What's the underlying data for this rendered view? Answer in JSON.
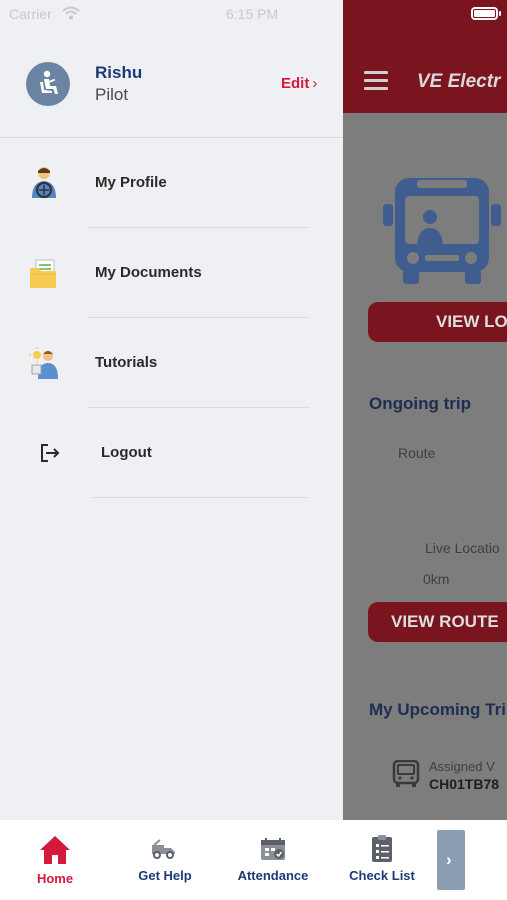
{
  "status_bar": {
    "carrier": "Carrier",
    "time": "6:15 PM"
  },
  "drawer": {
    "user": {
      "name": "Rishu",
      "role": "Pilot",
      "edit_label": "Edit"
    },
    "items": [
      {
        "label": "My Profile",
        "icon": "driver-profile-icon"
      },
      {
        "label": "My Documents",
        "icon": "documents-folder-icon"
      },
      {
        "label": "Tutorials",
        "icon": "tutorials-icon"
      },
      {
        "label": "Logout",
        "icon": "logout-icon"
      }
    ]
  },
  "app": {
    "title": "VE Electr",
    "view_location_label": "VIEW LO",
    "ongoing_trip_title": "Ongoing trip",
    "route_label": "Route",
    "live_location_label": "Live Locatio",
    "distance": "0km",
    "view_route_label": "VIEW ROUTE",
    "upcoming_title": "My Upcoming Tri",
    "assigned_label": "Assigned V",
    "assigned_value": "CH01TB78"
  },
  "tabbar": {
    "tabs": [
      {
        "label": "Home",
        "icon": "home-icon",
        "active": true
      },
      {
        "label": "Get Help",
        "icon": "tow-truck-icon",
        "active": false
      },
      {
        "label": "Attendance",
        "icon": "calendar-icon",
        "active": false
      },
      {
        "label": "Check List",
        "icon": "checklist-icon",
        "active": false
      }
    ],
    "scroll_glyph": "›"
  },
  "colors": {
    "accent": "#d41a3c",
    "primary_text": "#1c3b78",
    "drawer_bg": "#eff0f3",
    "topbar": "#a31d2c"
  }
}
